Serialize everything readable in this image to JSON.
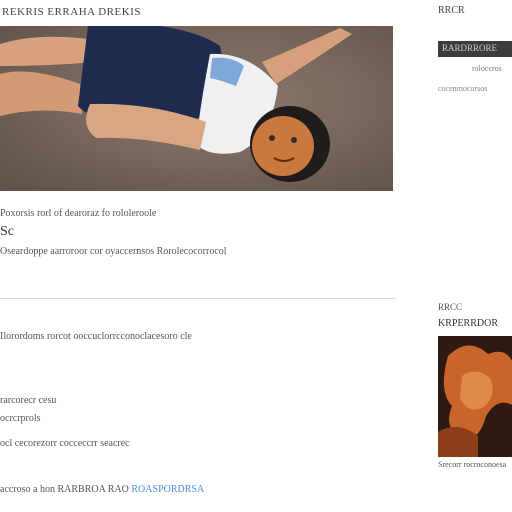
{
  "header": {
    "title": "REKRIS ERRAHA DREKIS"
  },
  "hero": {
    "image_alt": "child lying on carpet"
  },
  "article": {
    "caption": "Poxorsis rorl of dearoraz fo rololeroole",
    "title": "Sc",
    "byline": "Oseardoppe aarroroor cor oyaccernsos Rorolecocorrocol",
    "paragraph_1": "Ilorordoms rorcot ooccuclorrcconoclacesoro cle",
    "paragraph_2": "rarcorecr cesu",
    "paragraph_3": "ocrcrprols",
    "paragraph_4": "ocl cecorezorr cocceccrr seacrec",
    "footer_text": "accroso a hon RARBROA RAO",
    "footer_link": "ROASPORDRSA"
  },
  "sidebar": {
    "heading": "RRCR",
    "bar_text": "RARDRRORE",
    "meta_1": "roloccros",
    "meta_2": "cocenmocorsos",
    "label": "RRCC",
    "subheading": "KRPERRDOR",
    "thumb_caption": "Srecorr rocroconoesa",
    "thumb_alt": "orange abstract figure"
  }
}
